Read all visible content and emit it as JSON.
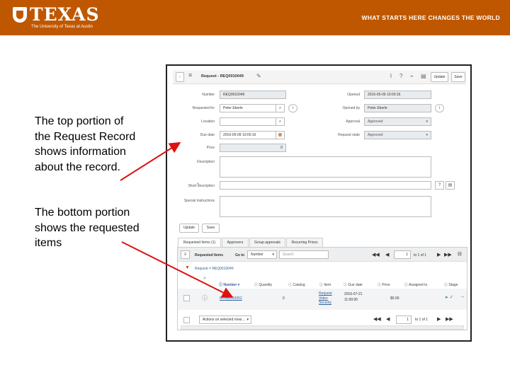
{
  "banner": {
    "logo_text": "TEXAS",
    "logo_subtitle": "The University of Texas at Austin",
    "tagline": "WHAT STARTS HERE CHANGES THE WORLD",
    "color": "#bf5700"
  },
  "captions": {
    "top": "The top portion of the Request Record shows information about the record.",
    "bottom": "The bottom portion shows the requested items"
  },
  "form": {
    "title": "Request - REQ0010049",
    "update_label": "Update",
    "save_label": "Save",
    "labels": {
      "number": "Number",
      "requested_for": "Requested for",
      "location": "Location",
      "due_date": "Due date",
      "price": "Price",
      "description": "Description",
      "short_description": "Short description",
      "special_instructions": "Special instructions",
      "opened": "Opened",
      "opened_by": "Opened by",
      "approval": "Approval",
      "request_state": "Request state"
    },
    "values": {
      "number": "REQ0010049",
      "requested_for": "Peter Eberle",
      "location": "",
      "due_date": "2016-05-09 10:00:16",
      "price": "0",
      "opened": "2016-05-09 10:00:16",
      "opened_by": "Peter Eberle",
      "approval": "Approved",
      "request_state": "Approved"
    },
    "bottom_update_label": "Update",
    "bottom_save_label": "Save"
  },
  "tabs": [
    {
      "label": "Requested Items (1)"
    },
    {
      "label": "Approvers"
    },
    {
      "label": "Group approvals"
    },
    {
      "label": "Recurring Prices"
    }
  ],
  "related_list": {
    "title": "Requested Items",
    "goto_label": "Go to",
    "goto_field": "Number",
    "search_placeholder": "Search",
    "page_value": "1",
    "page_of": "to 1 of 1",
    "filter": "Request = REQ0010049",
    "columns": [
      "Number",
      "Quantity",
      "Catalog",
      "Item",
      "Due date",
      "Price",
      "Assigned to",
      "Stage"
    ],
    "row": {
      "number": "RITM0010052",
      "quantity": "0",
      "item": "Request Video Security",
      "due_date": "2016-07-21 11:00:00",
      "price": "$0.00"
    },
    "actions_label": "Actions on selected rows...",
    "footer_page_value": "1",
    "footer_page_of": "to 1 of 1"
  }
}
